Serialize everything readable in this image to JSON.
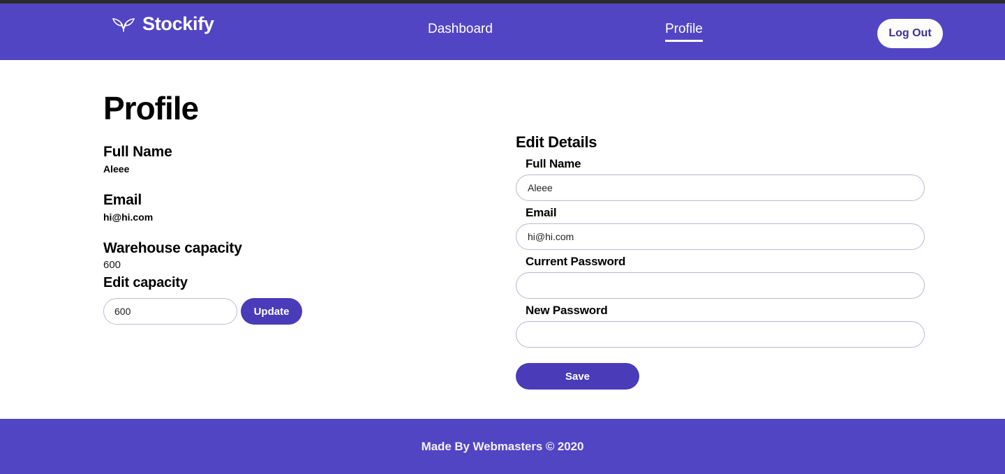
{
  "theme": {
    "brand_purple": "#5245c4",
    "button_purple": "#4a3bb8",
    "top_strip": "#2b2b2b",
    "page_bg": "#ffffff",
    "input_border": "#b9b6d4"
  },
  "header": {
    "brand_name": "Stockify",
    "brand_icon": "leaf-wings-icon",
    "nav": {
      "dashboard": "Dashboard",
      "profile": "Profile",
      "active": "Profile"
    },
    "logout_label": "Log Out"
  },
  "main": {
    "page_title": "Profile",
    "summary": {
      "full_name_label": "Full Name",
      "full_name_value": "Aleee",
      "email_label": "Email",
      "email_value": "hi@hi.com",
      "capacity_label": "Warehouse capacity",
      "capacity_value": "600",
      "edit_capacity_label": "Edit capacity",
      "capacity_input_value": "600",
      "capacity_input_placeholder": "",
      "update_label": "Update"
    },
    "edit_details": {
      "title": "Edit Details",
      "fields": [
        {
          "label": "Full Name",
          "value": "Aleee",
          "placeholder": "",
          "type": "text",
          "name": "full-name"
        },
        {
          "label": "Email",
          "value": "hi@hi.com",
          "placeholder": "",
          "type": "text",
          "name": "email"
        },
        {
          "label": "Current Password",
          "value": "",
          "placeholder": "",
          "type": "password",
          "name": "current-password"
        },
        {
          "label": "New Password",
          "value": "",
          "placeholder": "",
          "type": "password",
          "name": "new-password"
        }
      ],
      "save_label": "Save"
    }
  },
  "footer": {
    "text": "Made By Webmasters © 2020"
  }
}
